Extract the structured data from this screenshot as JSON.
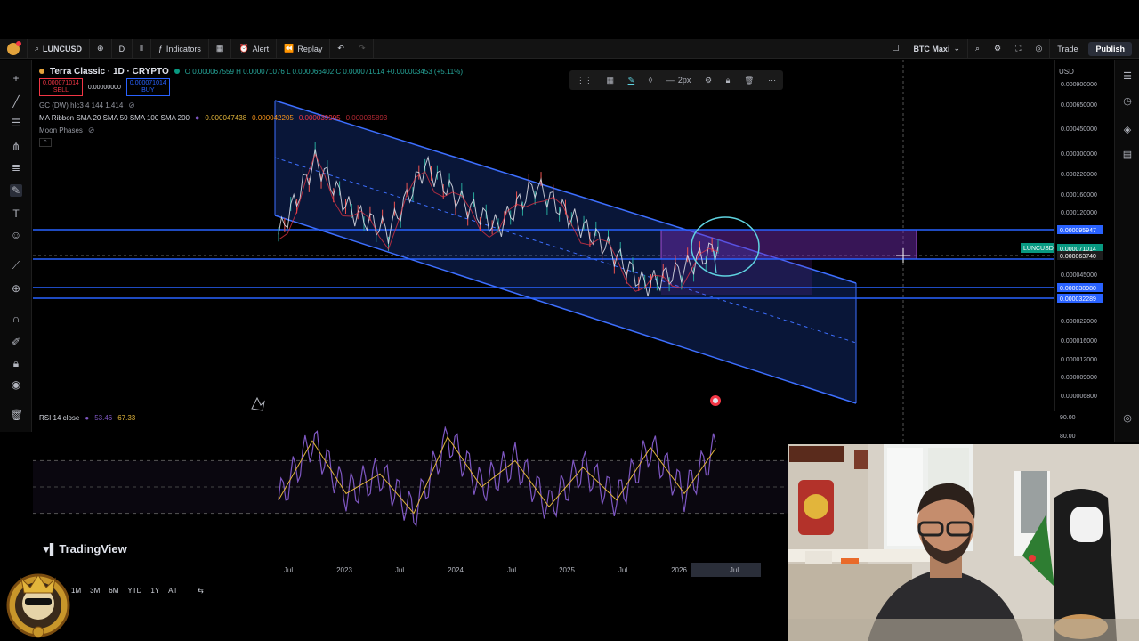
{
  "toolbar": {
    "symbol": "LUNCUSD",
    "interval": "D",
    "indicators_label": "Indicators",
    "alert_label": "Alert",
    "replay_label": "Replay",
    "layout_name": "BTC Maxi",
    "trade_label": "Trade",
    "publish_label": "Publish"
  },
  "legend": {
    "title": "Terra Classic · 1D · CRYPTO",
    "ohlc": "O 0.000067559 H 0.000071076 L 0.000066402 C 0.000071014 +0.000003453 (+5.11%)",
    "sell_price": "0.000071014",
    "sell_label": "SELL",
    "spread": "0.00000000",
    "buy_price": "0.000071014",
    "buy_label": "BUY",
    "indicator_1": "GC (DW) hlc3 4 144 1.414",
    "indicator_2_name": "MA Ribbon SMA 20 SMA 50 SMA 100 SMA 200",
    "indicator_2_v1": "0.000047438",
    "indicator_2_v2": "0.000042205",
    "indicator_2_v3": "0.000039905",
    "indicator_2_v4": "0.000035893",
    "indicator_3": "Moon Phases"
  },
  "draw_toolbar": {
    "width_label": "2px"
  },
  "price_scale": {
    "currency": "USD",
    "ticks": [
      "0.000900000",
      "0.000650000",
      "0.000450000",
      "0.000300000",
      "0.000220000",
      "0.000160000",
      "0.000120000",
      "0.000063740",
      "0.000045000",
      "0.000022000",
      "0.000016000",
      "0.000012000",
      "0.000009000",
      "0.000006800"
    ],
    "badges": [
      {
        "label": "0.000095947",
        "color": "#2962ff"
      },
      {
        "label": "0.000071014",
        "color": "#089981"
      },
      {
        "label": "0.000063740",
        "color": "#1e1e1e"
      },
      {
        "label": "0.000038980",
        "color": "#2962ff"
      },
      {
        "label": "0.000032289",
        "color": "#2962ff"
      }
    ],
    "symbol_badge": "LUNCUSD"
  },
  "rsi": {
    "label": "RSI 14 close",
    "value_1": "53.46",
    "value_2": "67.33",
    "scale_ticks": [
      "90.00",
      "80.00"
    ]
  },
  "time_axis": {
    "labels": [
      "Jul",
      "2023",
      "Jul",
      "2024",
      "Jul",
      "2025",
      "Jul",
      "2026",
      "Jul"
    ]
  },
  "bottom_bar": {
    "ranges": [
      "1M",
      "3M",
      "6M",
      "YTD",
      "1Y",
      "All"
    ]
  },
  "branding": {
    "tradingview": "TradingView"
  },
  "colors": {
    "channel": "#2962ff",
    "candle_up": "#26a69a",
    "candle_down": "#ef5350",
    "rsi_line": "#7e57c2",
    "rsi_ma": "#e2b53b",
    "annotation": "#5fd3e0",
    "zone": "#7b2fbe"
  },
  "chart_data": [
    {
      "type": "line",
      "title": "Terra Classic · 1D · CRYPTO",
      "y_scale": "log",
      "x": [
        "Jul",
        "2023",
        "Jul",
        "2024",
        "Jul",
        "2025",
        "Jul",
        "2026",
        "Jul"
      ],
      "ylim": [
        6.8e-06,
        0.0009
      ],
      "series": [
        {
          "values": [
            8.5e-05,
            0.00026,
            0.00012,
            9e-05,
            0.00024,
            0.00014,
            9.5e-05,
            0.00018,
            0.00011,
            7e-05,
            4e-05,
            5e-05,
            7.1e-05
          ]
        }
      ]
    },
    {
      "type": "line",
      "ylim": [
        0,
        100
      ],
      "series": [
        {
          "values": [
            40,
            85,
            45,
            60,
            30,
            88,
            50,
            70,
            35,
            65,
            40,
            80,
            45,
            82
          ]
        }
      ]
    }
  ]
}
